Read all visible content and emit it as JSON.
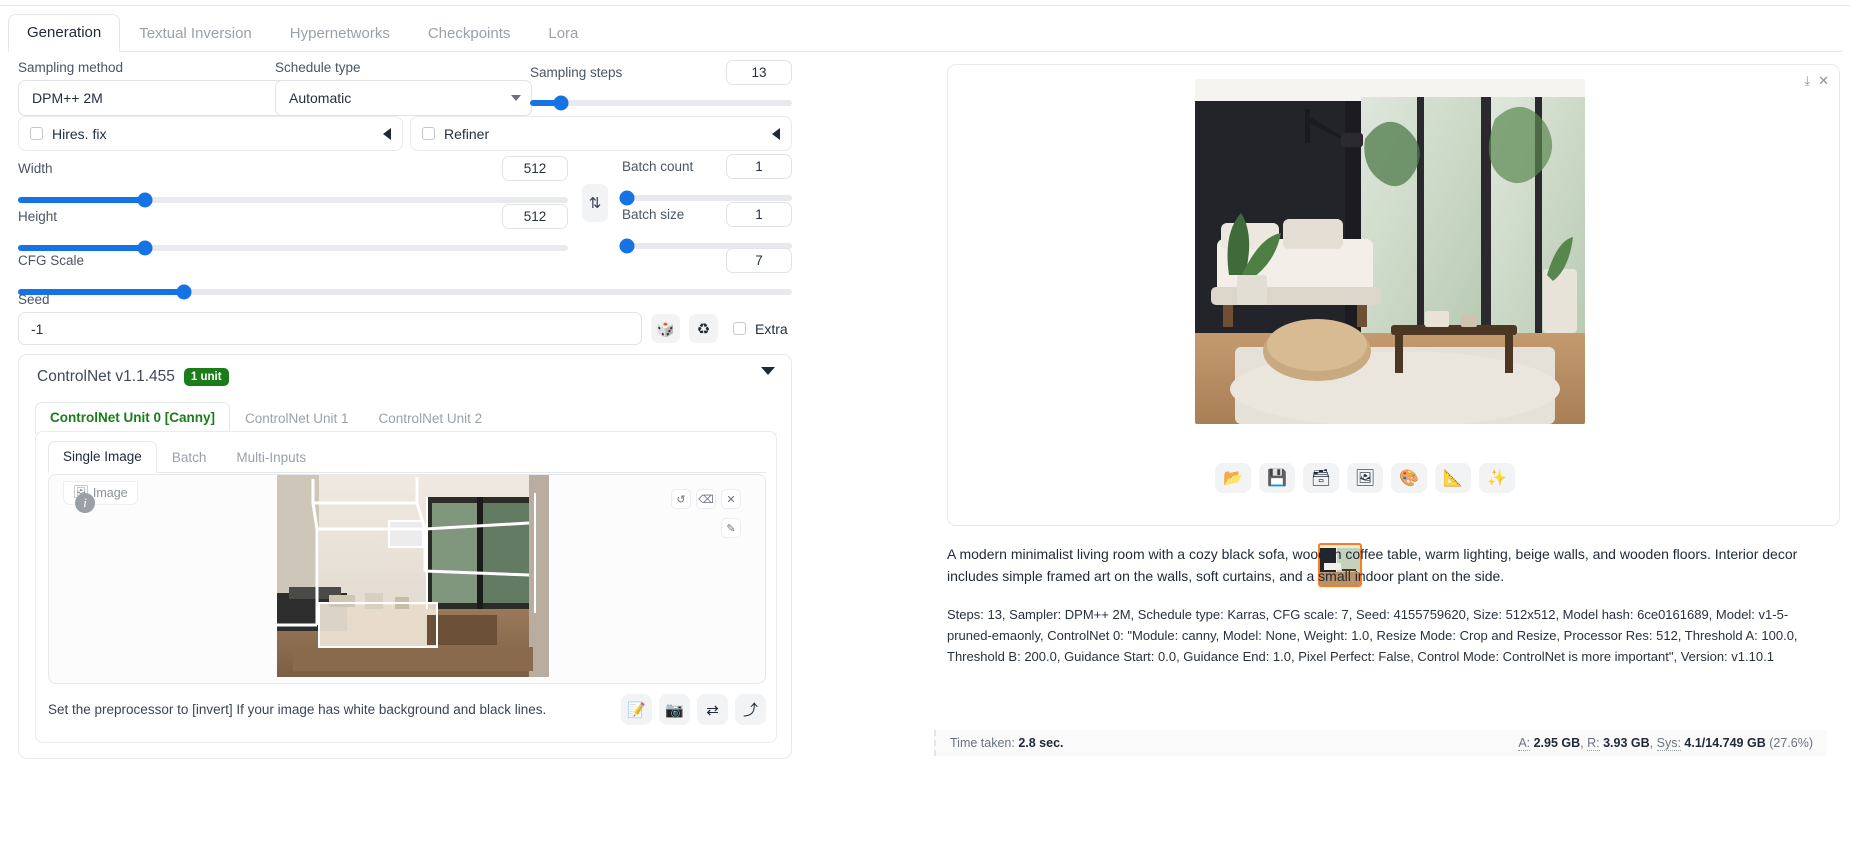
{
  "main_tabs": [
    {
      "label": "Generation",
      "active": true
    },
    {
      "label": "Textual Inversion",
      "active": false
    },
    {
      "label": "Hypernetworks",
      "active": false
    },
    {
      "label": "Checkpoints",
      "active": false
    },
    {
      "label": "Lora",
      "active": false
    }
  ],
  "generation": {
    "sampling_method": {
      "label": "Sampling method",
      "value": "DPM++ 2M"
    },
    "schedule_type": {
      "label": "Schedule type",
      "value": "Automatic"
    },
    "sampling_steps": {
      "label": "Sampling steps",
      "value": "13",
      "percent": 12
    },
    "hires_fix": {
      "label": "Hires. fix",
      "checked": false
    },
    "refiner": {
      "label": "Refiner",
      "checked": false
    },
    "width": {
      "label": "Width",
      "value": "512",
      "percent": 23
    },
    "height": {
      "label": "Height",
      "value": "512",
      "percent": 23
    },
    "batch_count": {
      "label": "Batch count",
      "value": "1",
      "percent": 0
    },
    "batch_size": {
      "label": "Batch size",
      "value": "1",
      "percent": 0
    },
    "cfg_scale": {
      "label": "CFG Scale",
      "value": "7",
      "percent": 29
    },
    "seed": {
      "label": "Seed",
      "value": "-1"
    },
    "extra": {
      "label": "Extra",
      "checked": false
    },
    "swap_icon": "swap-vertical-icon",
    "dice_icon": "dice-icon",
    "recycle_icon": "recycle-icon"
  },
  "controlnet": {
    "title": "ControlNet v1.1.455",
    "unit_badge": "1 unit",
    "unit_tabs": [
      {
        "label": "ControlNet Unit 0 [Canny]",
        "active": true
      },
      {
        "label": "ControlNet Unit 1",
        "active": false
      },
      {
        "label": "ControlNet Unit 2",
        "active": false
      }
    ],
    "input_tabs": [
      {
        "label": "Single Image",
        "active": true
      },
      {
        "label": "Batch",
        "active": false
      },
      {
        "label": "Multi-Inputs",
        "active": false
      }
    ],
    "image_tag": "Image",
    "info_glyph": "i",
    "preview_controls": [
      "undo-icon",
      "erase-icon",
      "close-icon"
    ],
    "edit_control": "pen-icon",
    "hint": "Set the preprocessor to [invert] If your image has white background and black lines.",
    "action_icons": [
      "edit-note-icon",
      "camera-icon",
      "swap-arrows-icon",
      "send-arrow-icon"
    ]
  },
  "result": {
    "panel_icons": [
      "download-icon",
      "close-icon"
    ],
    "toolbar": [
      {
        "name": "folder-icon",
        "glyph": "📂"
      },
      {
        "name": "save-icon",
        "glyph": "💾"
      },
      {
        "name": "card-file-box-icon",
        "glyph": "🗃"
      },
      {
        "name": "picture-icon",
        "glyph": "🖼"
      },
      {
        "name": "palette-icon",
        "glyph": "🎨"
      },
      {
        "name": "triangular-ruler-icon",
        "glyph": "📐"
      },
      {
        "name": "sparkles-icon",
        "glyph": "✨"
      }
    ],
    "prompt": "A modern minimalist living room with a cozy black sofa, wooden coffee table, warm lighting, beige walls, and wooden floors. Interior decor includes simple framed art on the walls, soft curtains, and a small indoor plant on the side.",
    "metadata": "Steps: 13, Sampler: DPM++ 2M, Schedule type: Karras, CFG scale: 7, Seed: 4155759620, Size: 512x512, Model hash: 6ce0161689, Model: v1-5-pruned-emaonly, ControlNet 0: \"Module: canny, Model: None, Weight: 1.0, Resize Mode: Crop and Resize, Processor Res: 512, Threshold A: 100.0, Threshold B: 200.0, Guidance Start: 0.0, Guidance End: 1.0, Pixel Perfect: False, Control Mode: ControlNet is more important\", Version: v1.10.1",
    "status": {
      "time_label": "Time taken:",
      "time_value": "2.8 sec.",
      "a_label": "A:",
      "a_value": "2.95 GB",
      "r_label": "R:",
      "r_value": "3.93 GB",
      "sys_label": "Sys:",
      "sys_value": "4.1/14.749 GB",
      "sys_percent": "(27.6%)"
    }
  },
  "colors": {
    "accent_blue": "#1673e6",
    "badge_green": "#1a7d1a",
    "tab_green": "#1a7d1a",
    "thumb_border": "#ff7a1a"
  }
}
